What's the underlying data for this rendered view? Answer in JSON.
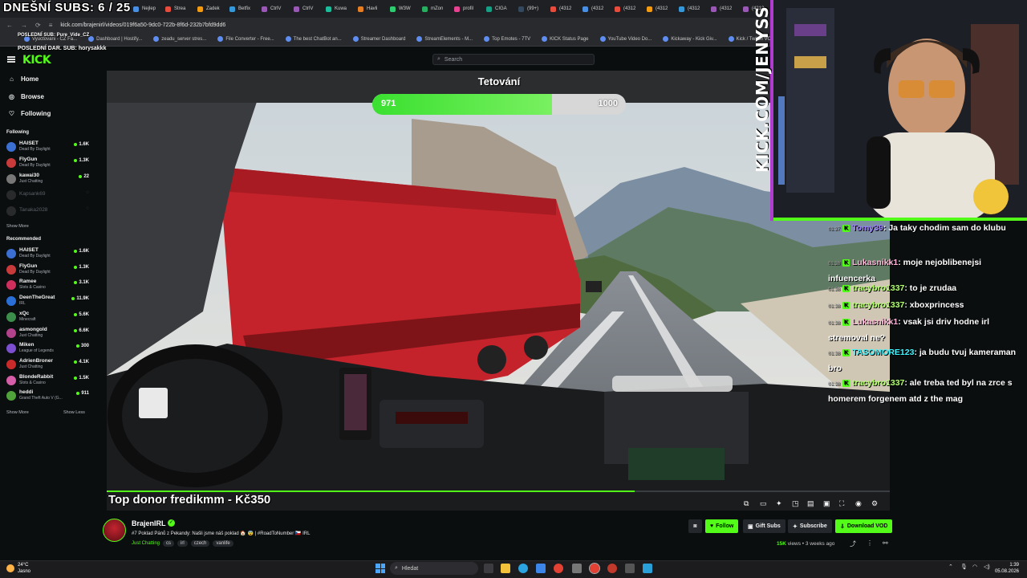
{
  "overlay": {
    "subs_counter": "DNEŠNÍ SUBS: 6 / 25",
    "last_sub": "POSLEDNÍ SUB: Pure_Vide_CZ",
    "last_donation": "POSLEDNÍ DAR. SUB: horysakkk",
    "goal_title": "Tetování",
    "goal_current": "971",
    "goal_target": "1000",
    "goal_fraction": 0.71,
    "top_donation": "Top donor fredikmm - Kč350",
    "webcam_text": "KICK.COM/JENYSS"
  },
  "browser": {
    "tabs": [
      "Nejlep",
      "Strea",
      "Zadek",
      "Betfix",
      "CtrlV",
      "CtrlV",
      "Kuwa",
      "Havli",
      "W3W",
      "mZon",
      "profil",
      "CIGA",
      "(99+)",
      "(4312",
      "(4312",
      "(4312",
      "(4312",
      "(4312",
      "(4312",
      "(4312",
      "(4312"
    ],
    "url": "kick.com/brajenirl/videos/019f6a50-9dc0-722b-8f6d-232b7bfd9dd6",
    "bookmarks": [
      "Vyuctovani - CZ Fa...",
      "Dashboard | Hostify...",
      "zeadu_server stres...",
      "File Converter - Free...",
      "The best ChatBot an...",
      "Streamer Dashboard",
      "StreamElements - M...",
      "Top Emotes - 7TV",
      "KICK Status Page",
      "YouTube Video Do...",
      "Kickaway - Kick Giv...",
      "Kick / Twitch VOD d..."
    ]
  },
  "header": {
    "logo": "KICK",
    "search_placeholder": "Search"
  },
  "sidebar": {
    "nav": [
      {
        "label": "Home",
        "icon": "home-icon"
      },
      {
        "label": "Browse",
        "icon": "compass-icon"
      },
      {
        "label": "Following",
        "icon": "heart-icon"
      }
    ],
    "following_title": "Following",
    "following": [
      {
        "name": "HAISET",
        "category": "Dead By Daylight",
        "viewers": "1.6K",
        "color": "#3b6fd1"
      },
      {
        "name": "FlyGun",
        "category": "Dead By Daylight",
        "viewers": "1.3K",
        "color": "#c93b3b"
      },
      {
        "name": "kawai30",
        "category": "Just Chatting",
        "viewers": "22",
        "color": "#777"
      },
      {
        "name": "Kapsank69",
        "category": "",
        "viewers": "",
        "color": "#555"
      },
      {
        "name": "Tanaka2028",
        "category": "",
        "viewers": "",
        "color": "#555"
      }
    ],
    "show_more": "Show More",
    "recommended_title": "Recommended",
    "recommended": [
      {
        "name": "HAISET",
        "category": "Dead By Daylight",
        "viewers": "1.6K",
        "color": "#3b6fd1"
      },
      {
        "name": "FlyGun",
        "category": "Dead By Daylight",
        "viewers": "1.3K",
        "color": "#c93b3b"
      },
      {
        "name": "Ramee",
        "category": "Slots & Casino",
        "viewers": "3.1K",
        "color": "#cf2f5d"
      },
      {
        "name": "DeenTheGreat",
        "category": "IRL",
        "viewers": "11.9K",
        "color": "#2a6fd6"
      },
      {
        "name": "xQc",
        "category": "Minecraft",
        "viewers": "5.6K",
        "color": "#3c8f4a"
      },
      {
        "name": "asmongold",
        "category": "Just Chatting",
        "viewers": "6.6K",
        "color": "#b2428c"
      },
      {
        "name": "Miken",
        "category": "League of Legends",
        "viewers": "300",
        "color": "#7c4fd1"
      },
      {
        "name": "AdrienBroner",
        "category": "Just Chatting",
        "viewers": "4.1K",
        "color": "#c92b2b"
      },
      {
        "name": "BlondeRabbit",
        "category": "Slots & Casino",
        "viewers": "1.5K",
        "color": "#d65ea8"
      },
      {
        "name": "heddi",
        "category": "Grand Theft Auto V (G...",
        "viewers": "911",
        "color": "#4fa33a"
      }
    ],
    "show_more_2": "Show More",
    "show_less": "Show Less"
  },
  "chat": [
    {
      "time": "01:37",
      "user": "Tomy39",
      "text": ": Ja taky chodim sam do klubu",
      "color": "#9b7bff"
    },
    {
      "time": "01:38",
      "user": "Lukasnikk1",
      "text": ": moje nejoblibenejsi infuencerka",
      "color": "#ffb7d9"
    },
    {
      "time": "01:38",
      "user": "tracybro1337",
      "text": ": to je zrudaa",
      "color": "#b4ff6e"
    },
    {
      "time": "01:38",
      "user": "tracybro1337",
      "text": ": xboxprincess",
      "color": "#b4ff6e"
    },
    {
      "time": "01:38",
      "user": "Lukasnikk1",
      "text": ": vsak jsi driv hodne irl stremoval ne?",
      "color": "#ffb7d9"
    },
    {
      "time": "01:38",
      "user": "TASOMORE123",
      "text": ": ja budu tvuj kameraman bro",
      "color": "#3ff5ff"
    },
    {
      "time": "01:38",
      "user": "tracybro1337",
      "text": ": ale treba ted byl na zrce s homerem forgenem atd z the mag",
      "color": "#b4ff6e"
    }
  ],
  "video_player": {
    "progress_fraction": 0.674
  },
  "stream_info": {
    "streamer": "BrajenIRL",
    "title": "#7 Poklad Pánů z Pekandy: Našli jsme náš poklad 🏠 😨 | #RoadToNumber 🇨🇿 IRL",
    "category": "Just Chatting",
    "tags": [
      "cs",
      "irl",
      "czech",
      "vanlife"
    ],
    "follow_label": "Follow",
    "gift_label": "Gift Subs",
    "subscribe_label": "Subscribe",
    "download_label": "Download VOD",
    "views": "15K",
    "views_suffix": " views",
    "ago": "3 weeks ago"
  },
  "taskbar": {
    "weather_temp": "24°C",
    "weather_desc": "Jasno",
    "search_label": "Hledat",
    "time": "1:39",
    "date": "05.08.2026"
  },
  "colors": {
    "accent": "#53fc18",
    "bg": "#0b0e0f"
  }
}
